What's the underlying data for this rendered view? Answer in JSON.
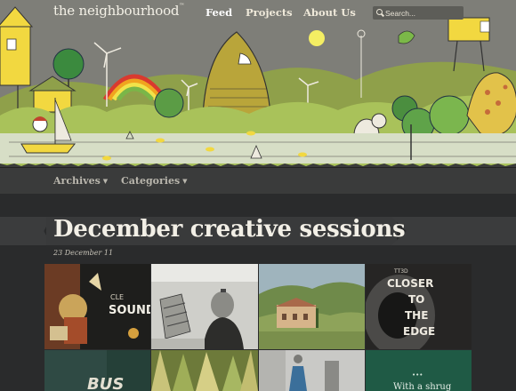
{
  "site": {
    "logo": "the neighbourhood",
    "logo_mark": "™"
  },
  "nav": {
    "feed": "Feed",
    "projects": "Projects",
    "about": "About Us",
    "search_placeholder": "Search..."
  },
  "subnav": {
    "archives": "Archives",
    "categories": "Categories",
    "caret": "▼"
  },
  "post": {
    "title": "December creative sessions",
    "date": "23 December 11"
  },
  "gallery": {
    "tile1_text": "SOUND",
    "tile1_small": "CLE",
    "tile4_kicker": "TT3D",
    "tile4_lines": [
      "CLOSER",
      "TO",
      "THE",
      "EDGE"
    ],
    "tile5_text": "BUS",
    "tile8_text": "With a shrug",
    "tile8_dots": "•••"
  },
  "colors": {
    "page_bg": "#2a2b2c",
    "header_bg": "#7d7d76",
    "subnav_bg": "#3a3b3b",
    "title_text": "#f2efe6",
    "green_tile": "#1f5a45",
    "rainbow": [
      "#d93a2f",
      "#f0a41f",
      "#f1e34a",
      "#7ab648",
      "#3b8ec7"
    ]
  }
}
